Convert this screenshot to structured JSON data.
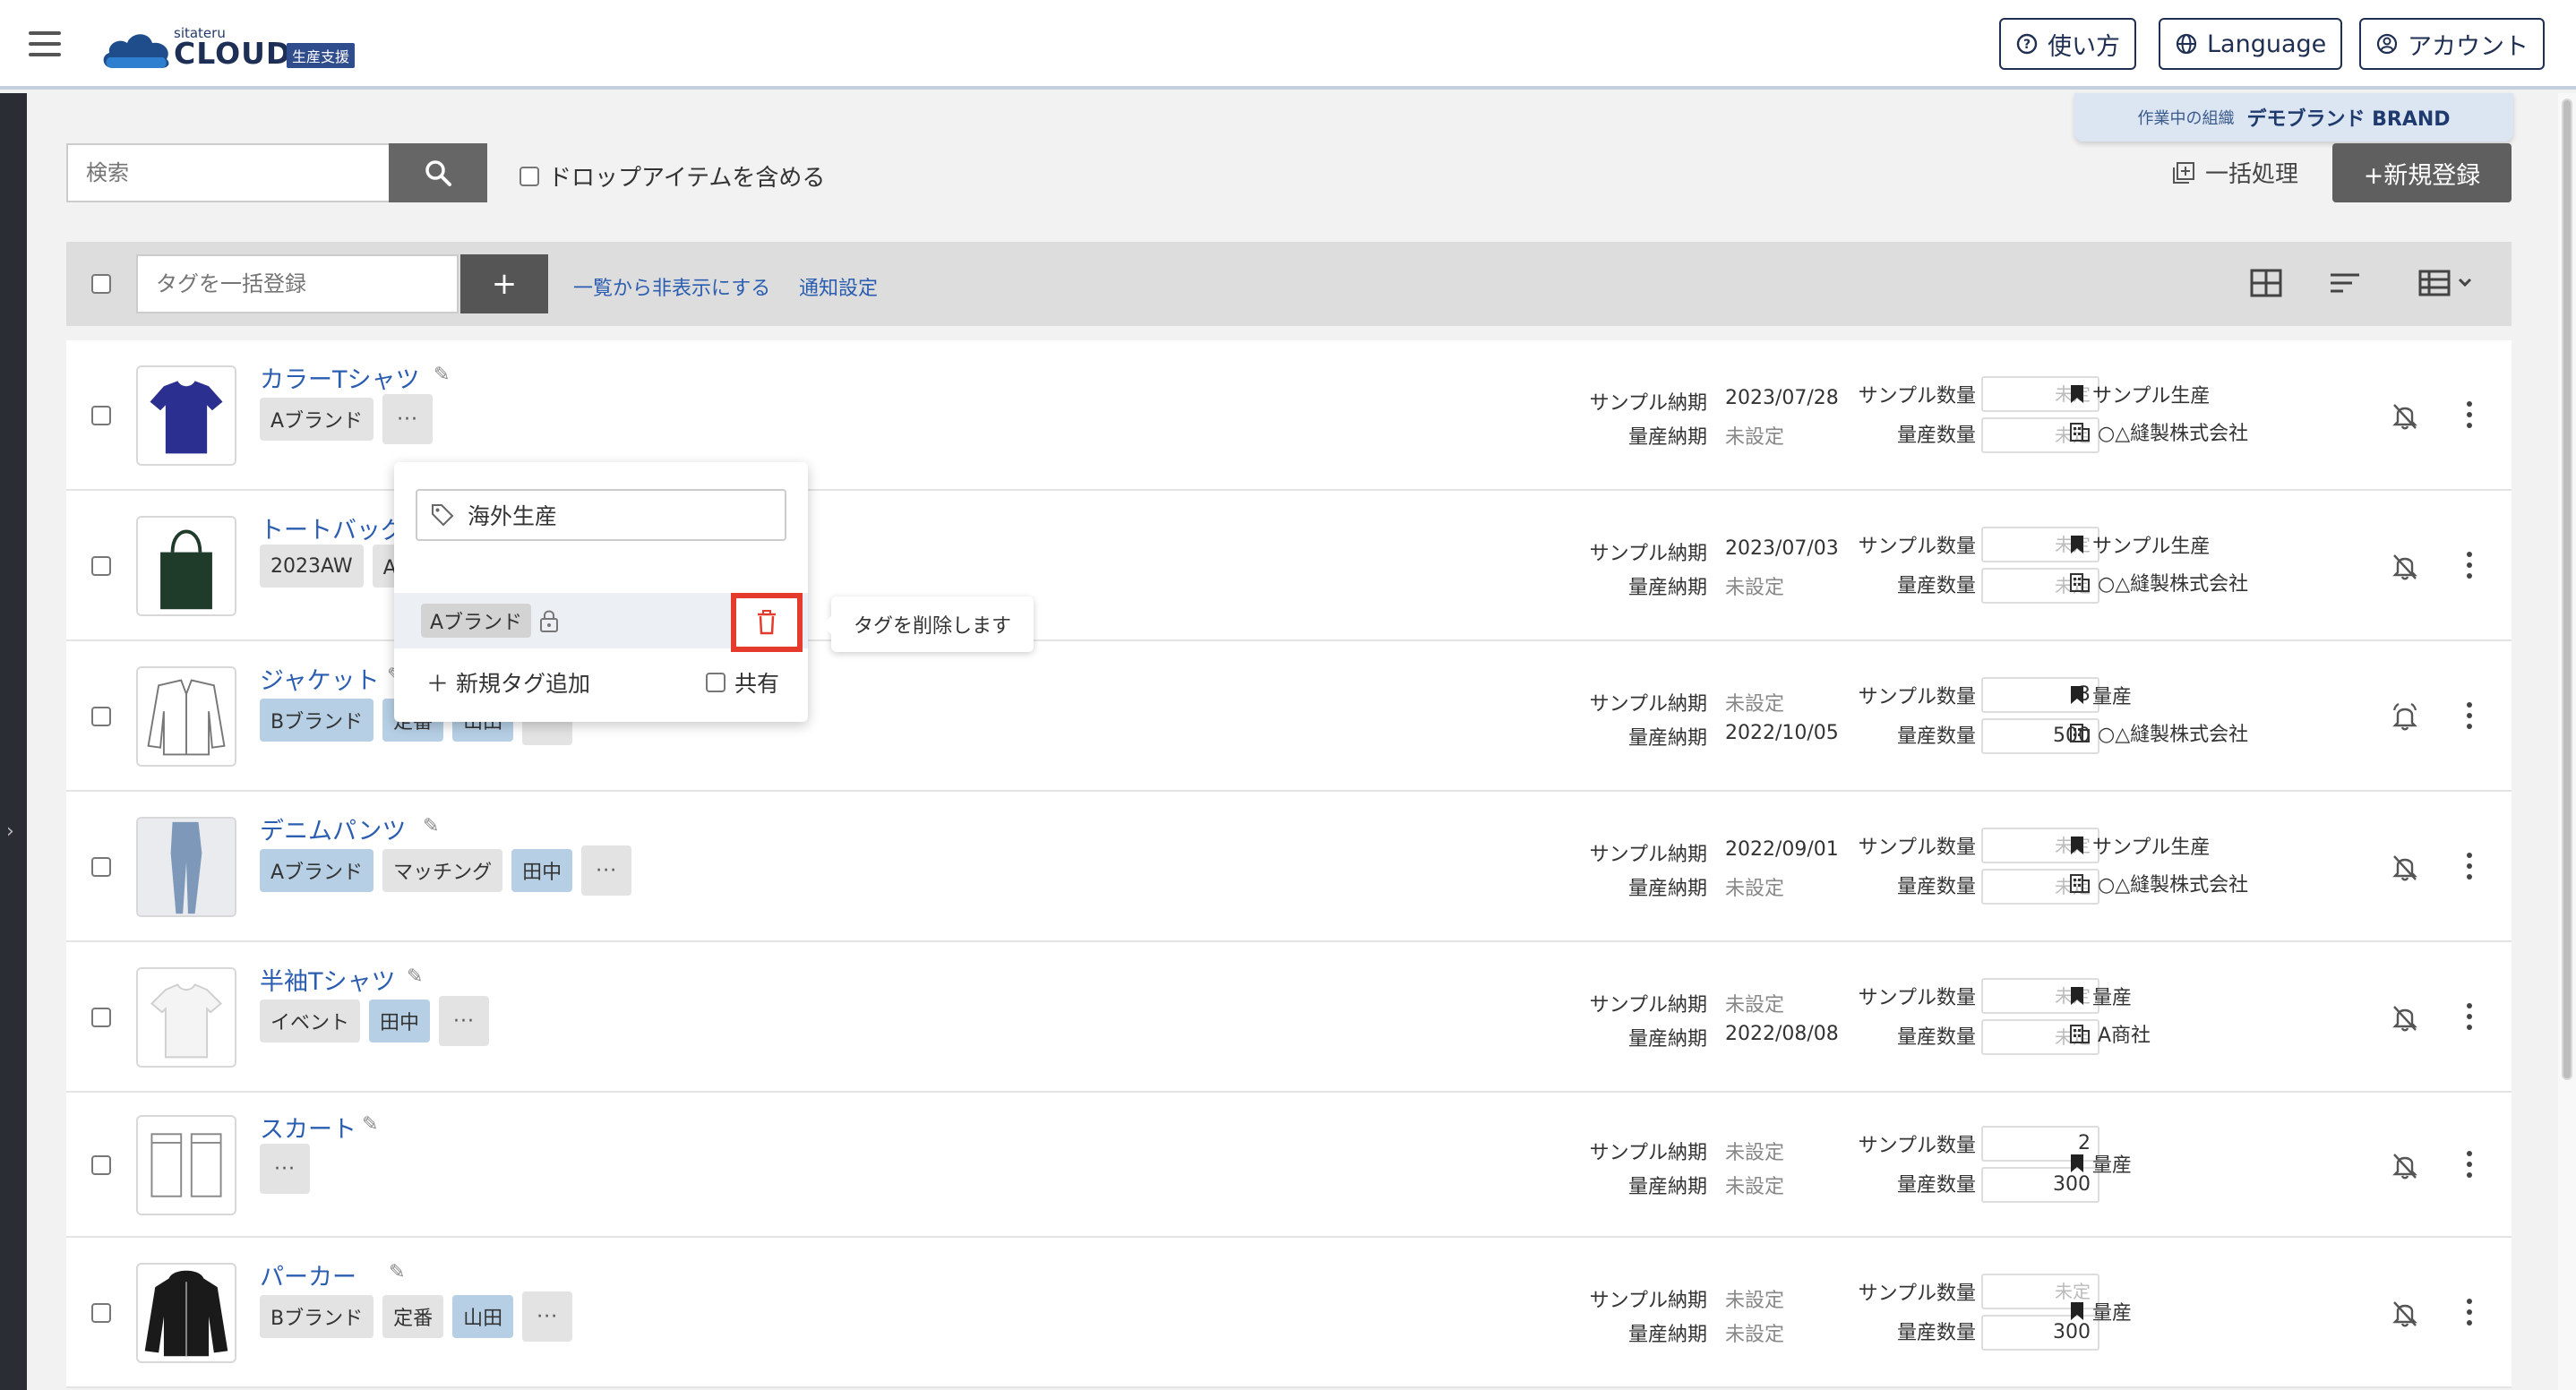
{
  "header": {
    "logo_small": "sitateru",
    "logo_main": "CLOUD",
    "logo_badge": "生産支援",
    "help_label": "使い方",
    "language_label": "Language",
    "account_label": "アカウント"
  },
  "org": {
    "label": "作業中の組織",
    "name": "デモブランド BRAND"
  },
  "search": {
    "placeholder": "検索",
    "drop_label": "ドロップアイテムを含める"
  },
  "actions": {
    "bulk_label": "一括処理",
    "new_label": "+新規登録"
  },
  "toolbar": {
    "tag_placeholder": "タグを一括登録",
    "add_label": "+",
    "hide_label": "一覧から非表示にする",
    "notify_label": "通知設定"
  },
  "labels": {
    "sample_due": "サンプル納期",
    "mass_due": "量産納期",
    "sample_qty": "サンプル数量",
    "mass_qty": "量産数量",
    "more": "···"
  },
  "products": [
    {
      "name": "カラーTシャツ",
      "tags": [
        {
          "label": "Aブランド",
          "style": "g"
        }
      ],
      "sample_due": "2023/07/28",
      "mass_due": "未設定",
      "sample_qty": "未定",
      "mass_qty": "未定",
      "status": "サンプル生産",
      "factory": "○△縫製株式会社",
      "notify": "off"
    },
    {
      "name": "トートバッグ",
      "tags": [
        {
          "label": "2023AW",
          "style": "g"
        },
        {
          "label": "Aブ",
          "style": "g"
        }
      ],
      "sample_due": "2023/07/03",
      "mass_due": "未設定",
      "sample_qty": "未定",
      "mass_qty": "未定",
      "status": "サンプル生産",
      "factory": "○△縫製株式会社",
      "notify": "off"
    },
    {
      "name": "ジャケット",
      "tags": [
        {
          "label": "Bブランド",
          "style": "b"
        },
        {
          "label": "定番",
          "style": "b"
        },
        {
          "label": "山田",
          "style": "b"
        }
      ],
      "sample_due": "未設定",
      "mass_due": "2022/10/05",
      "sample_qty": "3",
      "mass_qty": "500",
      "status": "量産",
      "factory": "○△縫製株式会社",
      "notify": "on"
    },
    {
      "name": "デニムパンツ",
      "tags": [
        {
          "label": "Aブランド",
          "style": "b"
        },
        {
          "label": "マッチング",
          "style": "g"
        },
        {
          "label": "田中",
          "style": "b"
        }
      ],
      "sample_due": "2022/09/01",
      "mass_due": "未設定",
      "sample_qty": "未定",
      "mass_qty": "未定",
      "status": "サンプル生産",
      "factory": "○△縫製株式会社",
      "notify": "off"
    },
    {
      "name": "半袖Tシャツ",
      "tags": [
        {
          "label": "イベント",
          "style": "g"
        },
        {
          "label": "田中",
          "style": "b"
        }
      ],
      "sample_due": "未設定",
      "mass_due": "2022/08/08",
      "sample_qty": "未定",
      "mass_qty": "未定",
      "status": "量産",
      "factory": "A商社",
      "notify": "off"
    },
    {
      "name": "スカート",
      "tags": [],
      "sample_due": "未設定",
      "mass_due": "未設定",
      "sample_qty": "2",
      "mass_qty": "300",
      "status": "量産",
      "factory": "",
      "notify": "off"
    },
    {
      "name": "パーカー",
      "tags": [
        {
          "label": "Bブランド",
          "style": "g"
        },
        {
          "label": "定番",
          "style": "g"
        },
        {
          "label": "山田",
          "style": "b"
        }
      ],
      "sample_due": "未設定",
      "mass_due": "未設定",
      "sample_qty": "未定",
      "mass_qty": "300",
      "status": "量産",
      "factory": "",
      "notify": "off"
    }
  ],
  "popup": {
    "input_value": "海外生産",
    "tag_label": "Aブランド",
    "add_label": "新規タグ追加",
    "share_label": "共有",
    "tooltip": "タグを削除します"
  },
  "colors": {
    "link": "#2b5db0",
    "tag_blue": "#b6cfe5",
    "delete_red": "#e53b2c",
    "navy": "#1e2f52"
  }
}
